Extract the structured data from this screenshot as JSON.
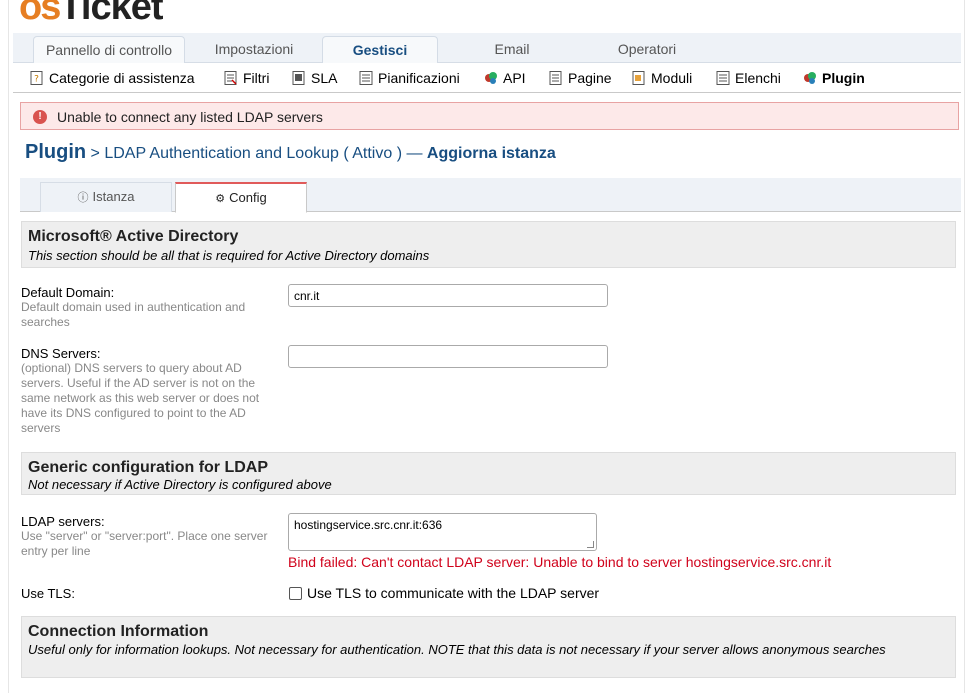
{
  "logo": {
    "part1": "os",
    "part2": "Ticket"
  },
  "nav": {
    "tabs": [
      {
        "label": "Pannello di controllo"
      },
      {
        "label": "Impostazioni"
      },
      {
        "label": "Gestisci"
      },
      {
        "label": "Email"
      },
      {
        "label": "Operatori"
      }
    ]
  },
  "subnav": {
    "items": [
      {
        "label": "Categorie di assistenza",
        "icon": "help-topics-icon"
      },
      {
        "label": "Filtri",
        "icon": "filters-icon"
      },
      {
        "label": "SLA",
        "icon": "sla-icon"
      },
      {
        "label": "Pianificazioni",
        "icon": "schedules-icon"
      },
      {
        "label": "API",
        "icon": "api-icon"
      },
      {
        "label": "Pagine",
        "icon": "pages-icon"
      },
      {
        "label": "Moduli",
        "icon": "forms-icon"
      },
      {
        "label": "Elenchi",
        "icon": "lists-icon"
      },
      {
        "label": "Plugin",
        "icon": "plugin-icon"
      }
    ]
  },
  "alert": {
    "text": "Unable to connect any listed LDAP servers",
    "icon": "!"
  },
  "heading": {
    "plugin": "Plugin",
    "rest": " > LDAP Authentication and Lookup ( Attivo ) — ",
    "action": "Aggiorna istanza"
  },
  "tabs": [
    {
      "label": "Istanza",
      "icon": "info-icon"
    },
    {
      "label": "Config",
      "icon": "gear-icon"
    }
  ],
  "sections": {
    "ad": {
      "title": "Microsoft® Active Directory",
      "desc": "This section should be all that is required for Active Directory domains"
    },
    "generic": {
      "title": "Generic configuration for LDAP",
      "desc": "Not necessary if Active Directory is configured above"
    },
    "conn": {
      "title": "Connection Information",
      "desc": "Useful only for information lookups. Not necessary for authentication. NOTE that this data is not necessary if your server allows anonymous searches"
    }
  },
  "fields": {
    "domain": {
      "label": "Default Domain:",
      "hint": "Default domain used in authentication and searches",
      "value": "cnr.it"
    },
    "dns": {
      "label": "DNS Servers:",
      "hint": "(optional) DNS servers to query about AD servers. Useful if the AD server is not on the same network as this web server or does not have its DNS configured to point to the AD servers",
      "value": ""
    },
    "servers": {
      "label": "LDAP servers:",
      "hint": "Use \"server\" or \"server:port\". Place one server entry per line",
      "value": "hostingservice.src.cnr.it:636",
      "error": "Bind failed: Can't contact LDAP server: Unable to bind to server hostingservice.src.cnr.it"
    },
    "tls": {
      "label": "Use TLS:",
      "checkbox_label": "Use TLS to communicate with the LDAP server",
      "checked": false
    }
  },
  "colors": {
    "brand_blue": "#184e81",
    "error_red": "#d0021b",
    "logo_orange": "#e67e22"
  }
}
